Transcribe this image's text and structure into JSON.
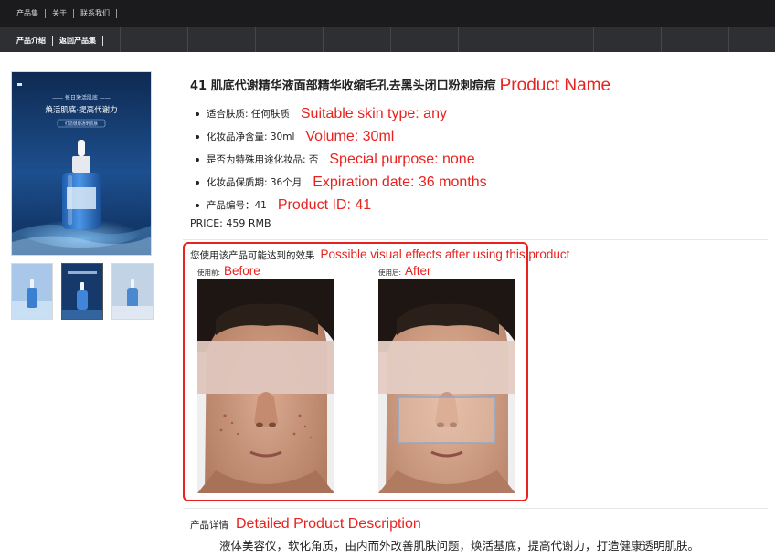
{
  "topnav": {
    "items": [
      "产品集",
      "关于",
      "联系我们"
    ]
  },
  "subnav": {
    "items": [
      "产品介绍",
      "返回产品集"
    ]
  },
  "product_image": {
    "banner_line1": "—— 每日激活肌底 ——",
    "banner_line2": "焕活肌底·提高代谢力",
    "banner_line3": "打造健康透明肌肤"
  },
  "product": {
    "title": "41 肌底代谢精华液面部精华收缩毛孔去黑头闭口粉刺痘痘",
    "title_annotation": "Product Name",
    "specs": [
      {
        "text": "适合肤质: 任何肤质",
        "annotation": "Suitable skin type: any"
      },
      {
        "text": "化妆品净含量: 30ml",
        "annotation": "Volume: 30ml"
      },
      {
        "text": "是否为特殊用途化妆品: 否",
        "annotation": "Special purpose: none"
      },
      {
        "text": "化妆品保质期: 36个月",
        "annotation": "Expiration date: 36 months"
      },
      {
        "text": "产品编号：41",
        "annotation": "Product ID: 41"
      }
    ],
    "price": "PRICE: 459 RMB"
  },
  "effects": {
    "title": "您使用该产品可能达到的效果",
    "title_annotation": "Possible visual effects after using this product",
    "before_label": "使用前:",
    "before_annotation": "Before",
    "after_label": "使用后:",
    "after_annotation": "After"
  },
  "details": {
    "label": "产品详情",
    "label_annotation": "Detailed Product Description",
    "text": "液体美容仪，软化角质，由内而外改善肌肤问题，焕活基底，提高代谢力，打造健康透明肌肤。"
  },
  "colors": {
    "annotation_red": "#e8231f",
    "topbar": "#1b1b1d",
    "subbar": "#2e2f33",
    "bottle_blue": "#2f72c8"
  },
  "icons": [
    "dropper-bottle-image",
    "face-photo-before",
    "face-photo-after"
  ]
}
